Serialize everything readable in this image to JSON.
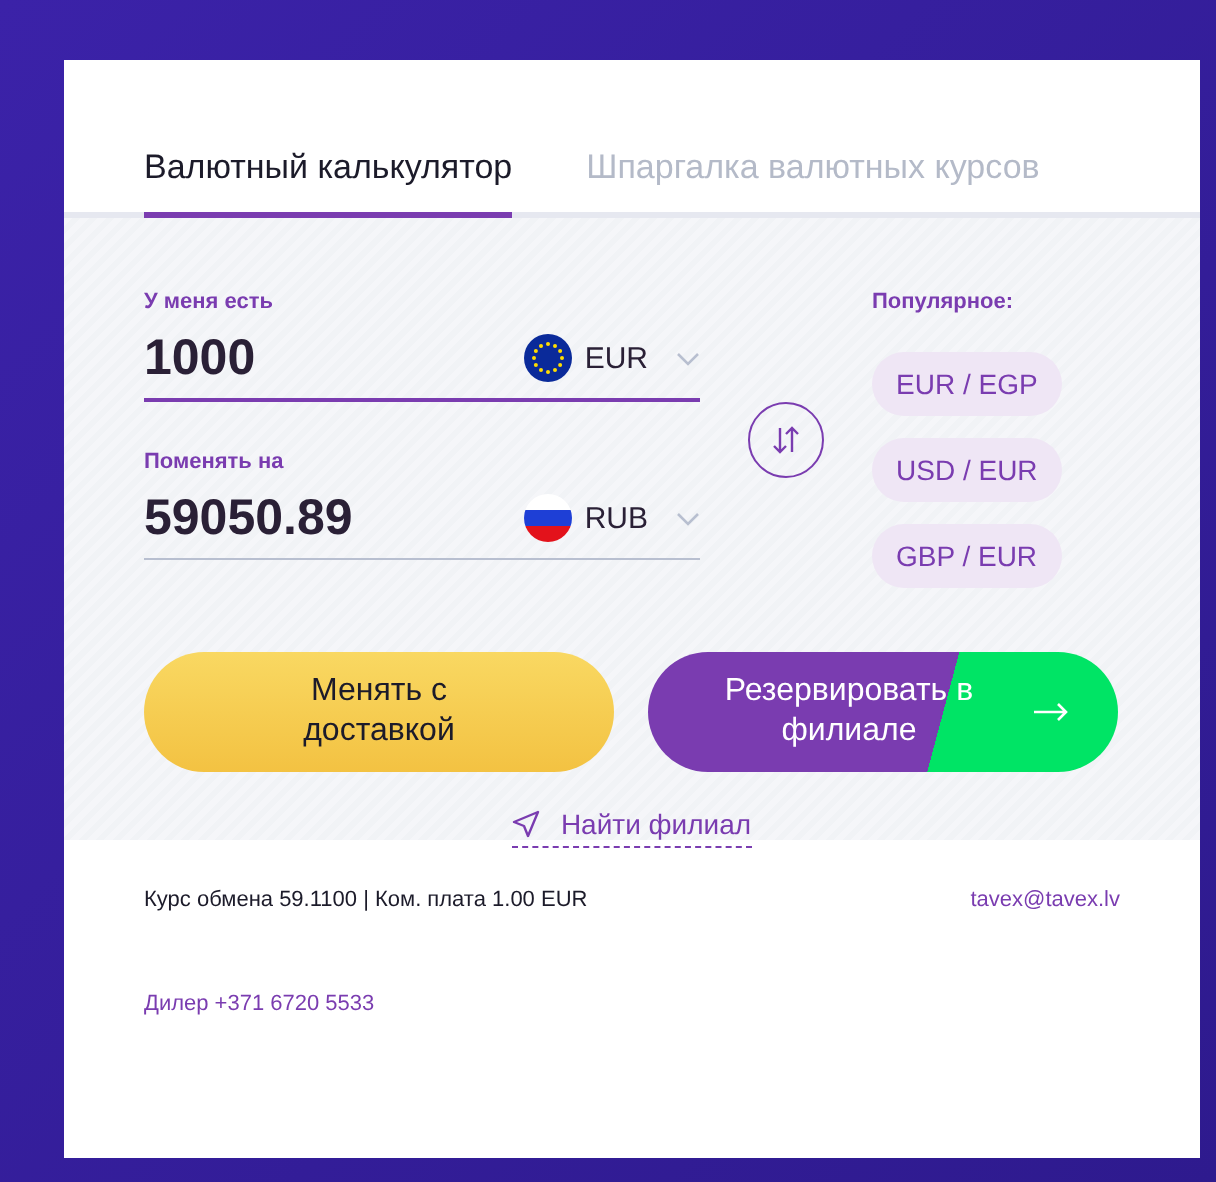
{
  "tabs": [
    {
      "label": "Валютный калькулятор",
      "selected": true
    },
    {
      "label": "Шпаргалка валютных курсов",
      "selected": false
    }
  ],
  "fields": [
    {
      "label": "У меня есть",
      "value": "1000",
      "currency": "EUR",
      "kind": "eu",
      "focused": true
    },
    {
      "label": "Поменять на",
      "value": "59050.89",
      "currency": "RUB",
      "kind": "ru",
      "focused": false
    }
  ],
  "popular": {
    "title": "Популярное:",
    "pairs": [
      "EUR / EGP",
      "USD / EUR",
      "GBP / EUR"
    ]
  },
  "buttons": {
    "delivery": "Менять с доставкой",
    "reserve": "Резервировать в филиале"
  },
  "find_branch": "Найти филиал",
  "footer": {
    "rate": "Курс обмена 59.1100 | Ком. плата 1.00 EUR",
    "email": "tavex@tavex.lv",
    "dealer": "Дилер +371 6720 5533"
  }
}
